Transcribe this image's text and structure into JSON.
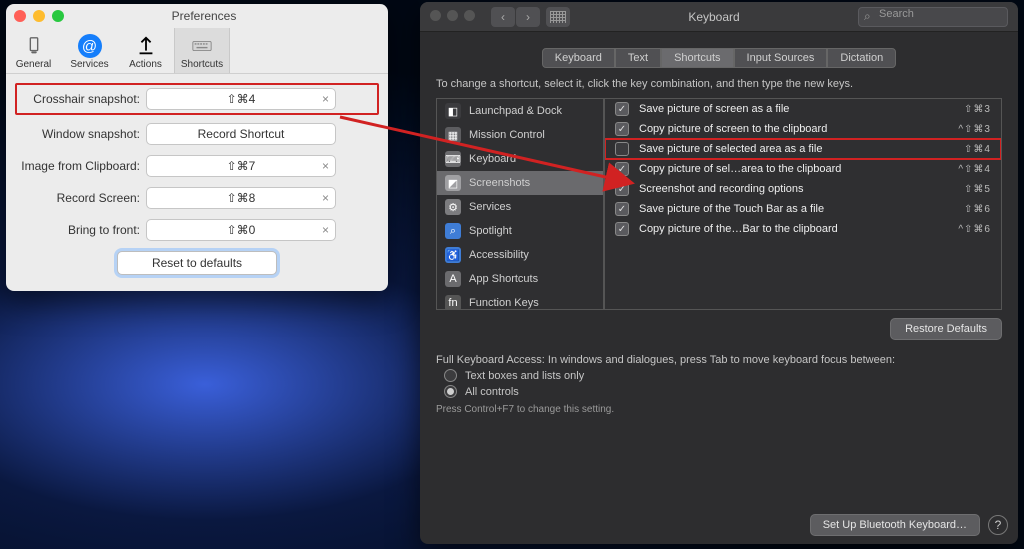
{
  "prefs": {
    "title": "Preferences",
    "toolbar": [
      {
        "label": "General"
      },
      {
        "label": "Services"
      },
      {
        "label": "Actions"
      },
      {
        "label": "Shortcuts"
      }
    ],
    "rows": [
      {
        "label": "Crosshair snapshot:",
        "value": "⇧⌘4",
        "clear": true,
        "highlight": true
      },
      {
        "label": "Window snapshot:",
        "value": "Record Shortcut",
        "clear": false
      },
      {
        "label": "Image from Clipboard:",
        "value": "⇧⌘7",
        "clear": true
      },
      {
        "label": "Record Screen:",
        "value": "⇧⌘8",
        "clear": true
      },
      {
        "label": "Bring to front:",
        "value": "⇧⌘0",
        "clear": true
      }
    ],
    "reset": "Reset to defaults"
  },
  "dark": {
    "title": "Keyboard",
    "search_placeholder": "Search",
    "tabs": [
      "Keyboard",
      "Text",
      "Shortcuts",
      "Input Sources",
      "Dictation"
    ],
    "tab_selected": 2,
    "desc": "To change a shortcut, select it, click the key combination, and then type the new keys.",
    "categories": [
      {
        "label": "Launchpad & Dock",
        "color": "#3b3b3e",
        "icon": "◧"
      },
      {
        "label": "Mission Control",
        "color": "#5d5d60",
        "icon": "▦"
      },
      {
        "label": "Keyboard",
        "color": "#6b6b6e",
        "icon": "⌨"
      },
      {
        "label": "Screenshots",
        "color": "#a0a0a3",
        "icon": "◩",
        "selected": true
      },
      {
        "label": "Services",
        "color": "#7c7c7f",
        "icon": "⚙"
      },
      {
        "label": "Spotlight",
        "color": "#3f7dd6",
        "icon": "⌕"
      },
      {
        "label": "Accessibility",
        "color": "#3f7dd6",
        "icon": "♿"
      },
      {
        "label": "App Shortcuts",
        "color": "#6b6b6e",
        "icon": "A"
      },
      {
        "label": "Function Keys",
        "color": "#555",
        "icon": "fn"
      }
    ],
    "shortcuts": [
      {
        "checked": true,
        "label": "Save picture of screen as a file",
        "key": "⇧⌘3"
      },
      {
        "checked": true,
        "label": "Copy picture of screen to the clipboard",
        "key": "^⇧⌘3"
      },
      {
        "checked": false,
        "label": "Save picture of selected area as a file",
        "key": "⇧⌘4",
        "highlight": true
      },
      {
        "checked": true,
        "label": "Copy picture of sel…area to the clipboard",
        "key": "^⇧⌘4"
      },
      {
        "checked": true,
        "label": "Screenshot and recording options",
        "key": "⇧⌘5"
      },
      {
        "checked": true,
        "label": "Save picture of the Touch Bar as a file",
        "key": "⇧⌘6"
      },
      {
        "checked": true,
        "label": "Copy picture of the…Bar to the clipboard",
        "key": "^⇧⌘6"
      }
    ],
    "restore": "Restore Defaults",
    "access_label": "Full Keyboard Access: In windows and dialogues, press Tab to move keyboard focus between:",
    "radio": [
      {
        "label": "Text boxes and lists only",
        "on": false
      },
      {
        "label": "All controls",
        "on": true
      }
    ],
    "hint": "Press Control+F7 to change this setting.",
    "bluetooth": "Set Up Bluetooth Keyboard…"
  }
}
